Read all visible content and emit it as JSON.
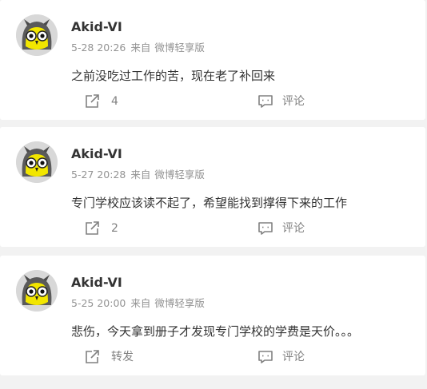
{
  "posts": [
    {
      "username": "Akid-VI",
      "time": "5-28 20:26",
      "source_prefix": "来自",
      "source": "微博轻享版",
      "content": "之前没吃过工作的苦，现在老了补回来",
      "repost": "4",
      "comment": "评论"
    },
    {
      "username": "Akid-VI",
      "time": "5-27 20:28",
      "source_prefix": "来自",
      "source": "微博轻享版",
      "content": "专门学校应该读不起了，希望能找到撑得下来的工作",
      "repost": "2",
      "comment": "评论"
    },
    {
      "username": "Akid-VI",
      "time": "5-25 20:00",
      "source_prefix": "来自",
      "source": "微博轻享版",
      "content": "悲伤，今天拿到册子才发现专门学校的学费是天价。。。",
      "repost": "转发",
      "comment": "评论"
    }
  ],
  "icons": {
    "repost": "repost-icon",
    "comment": "comment-icon",
    "avatar": "owl-avatar"
  },
  "colors": {
    "background": "#f2f2f2",
    "card": "#ffffff",
    "text": "#333333",
    "meta": "#939393",
    "action": "#808080",
    "owl_face": "#f2e600"
  }
}
